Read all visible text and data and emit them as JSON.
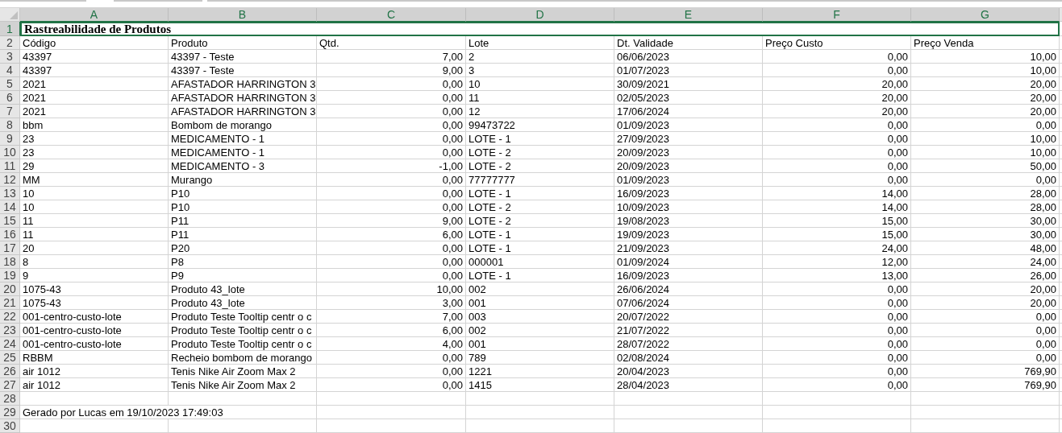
{
  "columns": [
    {
      "label": "A",
      "selected": true,
      "kind": "text"
    },
    {
      "label": "B",
      "selected": true,
      "kind": "text"
    },
    {
      "label": "C",
      "selected": true,
      "kind": "number"
    },
    {
      "label": "D",
      "selected": true,
      "kind": "text"
    },
    {
      "label": "E",
      "selected": true,
      "kind": "text"
    },
    {
      "label": "F",
      "selected": true,
      "kind": "number"
    },
    {
      "label": "G",
      "selected": true,
      "kind": "number"
    }
  ],
  "title": {
    "number": "1",
    "text": "Rastreabilidade de Produtos",
    "selected": true
  },
  "header": {
    "number": "2",
    "cells": [
      "Código",
      "Produto",
      "Qtd.",
      "Lote",
      "Dt. Validade",
      "Preço Custo",
      "Preço Venda"
    ]
  },
  "rows": [
    {
      "number": "3",
      "cells": [
        "43397",
        "43397 - Teste",
        "7,00",
        "2",
        "06/06/2023",
        "0,00",
        "10,00"
      ]
    },
    {
      "number": "4",
      "cells": [
        "43397",
        "43397 - Teste",
        "9,00",
        "3",
        "01/07/2023",
        "0,00",
        "10,00"
      ]
    },
    {
      "number": "5",
      "cells": [
        "2021",
        "AFASTADOR HARRINGTON 3",
        "0,00",
        "10",
        "30/09/2021",
        "20,00",
        "20,00"
      ]
    },
    {
      "number": "6",
      "cells": [
        "2021",
        "AFASTADOR HARRINGTON 3",
        "0,00",
        "11",
        "02/05/2023",
        "20,00",
        "20,00"
      ]
    },
    {
      "number": "7",
      "cells": [
        "2021",
        "AFASTADOR HARRINGTON 3",
        "0,00",
        "12",
        "17/06/2024",
        "20,00",
        "20,00"
      ]
    },
    {
      "number": "8",
      "cells": [
        "bbm",
        "Bombom de morango",
        "0,00",
        "99473722",
        "01/09/2023",
        "0,00",
        "0,00"
      ]
    },
    {
      "number": "9",
      "cells": [
        "23",
        "MEDICAMENTO - 1",
        "0,00",
        "LOTE - 1",
        "27/09/2023",
        "0,00",
        "10,00"
      ]
    },
    {
      "number": "10",
      "cells": [
        "23",
        "MEDICAMENTO - 1",
        "0,00",
        "LOTE - 2",
        "20/09/2023",
        "0,00",
        "10,00"
      ]
    },
    {
      "number": "11",
      "cells": [
        "29",
        "MEDICAMENTO - 3",
        "-1,00",
        "LOTE - 2",
        "20/09/2023",
        "0,00",
        "50,00"
      ]
    },
    {
      "number": "12",
      "cells": [
        "MM",
        "Murango",
        "0,00",
        "77777777",
        "01/09/2023",
        "0,00",
        "0,00"
      ]
    },
    {
      "number": "13",
      "cells": [
        "10",
        "P10",
        "0,00",
        "LOTE - 1",
        "16/09/2023",
        "14,00",
        "28,00"
      ]
    },
    {
      "number": "14",
      "cells": [
        "10",
        "P10",
        "0,00",
        "LOTE - 2",
        "10/09/2023",
        "14,00",
        "28,00"
      ]
    },
    {
      "number": "15",
      "cells": [
        "11",
        "P11",
        "9,00",
        "LOTE - 2",
        "19/08/2023",
        "15,00",
        "30,00"
      ]
    },
    {
      "number": "16",
      "cells": [
        "11",
        "P11",
        "6,00",
        "LOTE - 1",
        "19/09/2023",
        "15,00",
        "30,00"
      ]
    },
    {
      "number": "17",
      "cells": [
        "20",
        "P20",
        "0,00",
        "LOTE - 1",
        "21/09/2023",
        "24,00",
        "48,00"
      ]
    },
    {
      "number": "18",
      "cells": [
        "8",
        "P8",
        "0,00",
        "000001",
        "01/09/2024",
        "12,00",
        "24,00"
      ]
    },
    {
      "number": "19",
      "cells": [
        "9",
        "P9",
        "0,00",
        "LOTE - 1",
        "16/09/2023",
        "13,00",
        "26,00"
      ]
    },
    {
      "number": "20",
      "cells": [
        "1075-43",
        "Produto 43_lote",
        "10,00",
        "002",
        "26/06/2024",
        "0,00",
        "20,00"
      ]
    },
    {
      "number": "21",
      "cells": [
        "1075-43",
        "Produto 43_lote",
        "3,00",
        "001",
        "07/06/2024",
        "0,00",
        "20,00"
      ]
    },
    {
      "number": "22",
      "cells": [
        "001-centro-custo-lote",
        "Produto Teste Tooltip centr o c",
        "7,00",
        "003",
        "20/07/2022",
        "0,00",
        "0,00"
      ]
    },
    {
      "number": "23",
      "cells": [
        "001-centro-custo-lote",
        "Produto Teste Tooltip centr o c",
        "6,00",
        "002",
        "21/07/2022",
        "0,00",
        "0,00"
      ]
    },
    {
      "number": "24",
      "cells": [
        "001-centro-custo-lote",
        "Produto Teste Tooltip centr o c",
        "4,00",
        "001",
        "28/07/2022",
        "0,00",
        "0,00"
      ]
    },
    {
      "number": "25",
      "cells": [
        "RBBM",
        "Recheio bombom de morango",
        "0,00",
        "789",
        "02/08/2024",
        "0,00",
        "0,00"
      ]
    },
    {
      "number": "26",
      "cells": [
        "air 1012",
        "Tenis Nike Air Zoom Max 2",
        "0,00",
        "1221",
        "20/04/2023",
        "0,00",
        "769,90"
      ]
    },
    {
      "number": "27",
      "cells": [
        "air 1012",
        "Tenis Nike Air Zoom Max 2",
        "0,00",
        "1415",
        "28/04/2023",
        "0,00",
        "769,90"
      ]
    },
    {
      "number": "28",
      "cells": []
    }
  ],
  "footer": {
    "number": "29",
    "text": "Gerado por Lucas em 19/10/2023 17:49:03"
  },
  "trailing_rows": [
    {
      "number": "30"
    }
  ]
}
